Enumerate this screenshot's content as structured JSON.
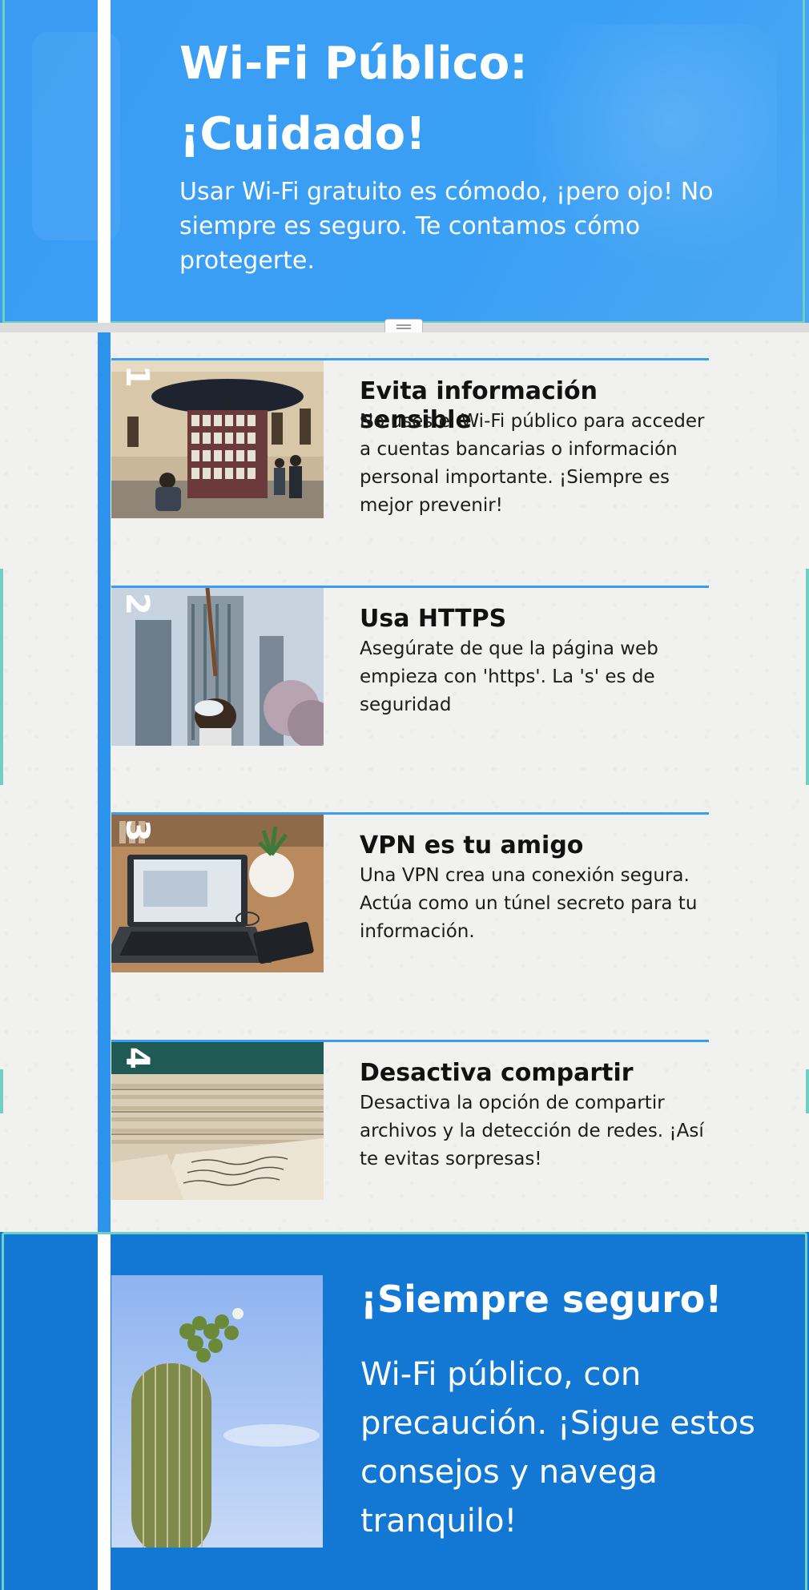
{
  "hero": {
    "title": "Wi-Fi Público: ¡Cuidado!",
    "subtitle": "Usar Wi-Fi gratuito es cómodo, ¡pero ojo! No siempre es seguro. Te contamos cómo protegerte."
  },
  "steps": [
    {
      "number": "1",
      "title": "Evita información sensible",
      "description": "No uses el Wi-Fi público para acceder a cuentas bancarias o información personal importante. ¡Siempre es mejor prevenir!",
      "image": "street-vendor-photo"
    },
    {
      "number": "2",
      "title": "Usa HTTPS",
      "description": "Asegúrate de que la página web empieza con 'https'. La 's' es de seguridad",
      "image": "skyscraper-photo"
    },
    {
      "number": "3",
      "title": "VPN es tu amigo",
      "description": "Una VPN crea una conexión segura. Actúa como un túnel secreto para tu información.",
      "image": "laptop-desk-photo"
    },
    {
      "number": "4",
      "title": "Desactiva compartir",
      "description": "Desactiva la opción de compartir archivos y la detección de redes. ¡Así te evitas sorpresas!",
      "image": "paper-stack-photo"
    }
  ],
  "footer": {
    "title": "¡Siempre seguro!",
    "text": "Wi-Fi público, con precaución. ¡Sigue estos consejos y navega tranquilo!",
    "image": "cactus-photo"
  },
  "colors": {
    "hero_blue": "#3a9cf3",
    "rail_blue": "#2e93ec",
    "footer_blue": "#1278d3",
    "frame_teal": "#6fcfc0"
  }
}
